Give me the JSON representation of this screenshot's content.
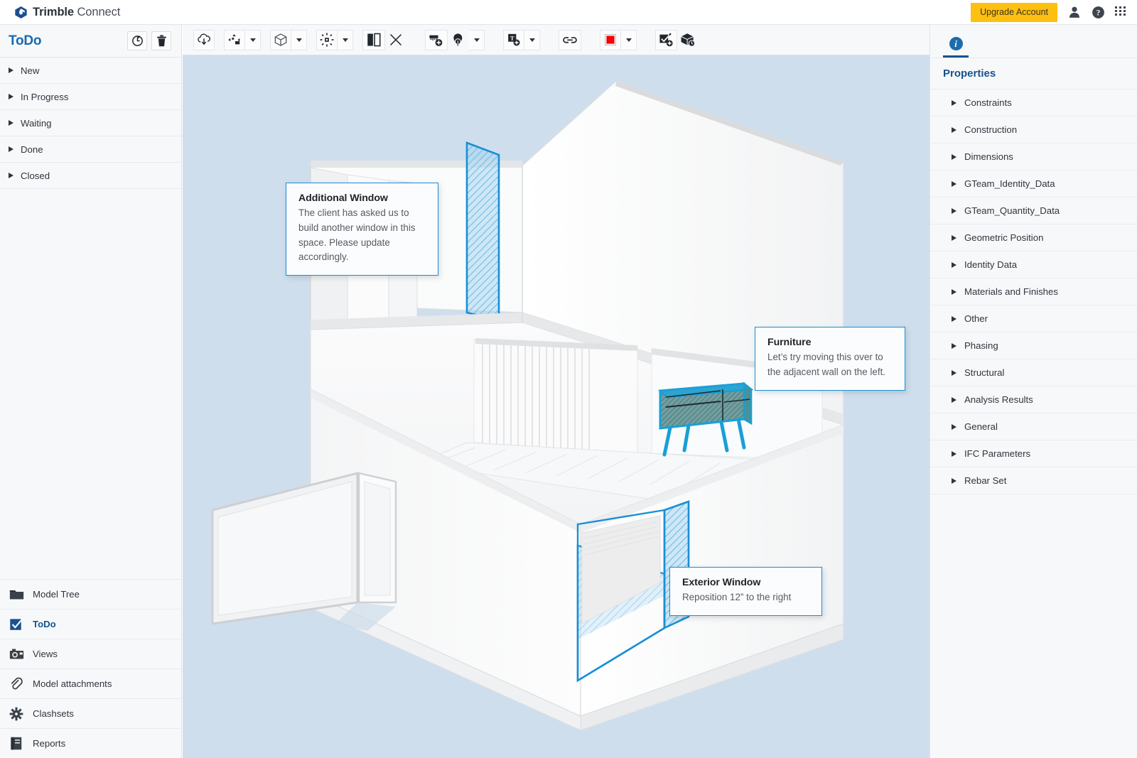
{
  "header": {
    "brand_bold": "Trimble",
    "brand_light": "Connect",
    "brand_logo_icon": "trimble-logo-icon",
    "upgrade_label": "Upgrade Account",
    "user_icon": "user-icon",
    "help_icon": "help-question-icon",
    "apps_icon": "apps-grid-icon",
    "accent_yellow": "#fdc010"
  },
  "sidebar": {
    "title": "ToDo",
    "title_color": "#1a69b0",
    "actions": [
      {
        "name": "refresh-button",
        "icon": "refresh-sync-icon"
      },
      {
        "name": "delete-button",
        "icon": "trash-icon"
      }
    ],
    "statuses": [
      {
        "label": "New"
      },
      {
        "label": "In Progress"
      },
      {
        "label": "Waiting"
      },
      {
        "label": "Done"
      },
      {
        "label": "Closed"
      }
    ],
    "nav": [
      {
        "label": "Model Tree",
        "icon": "folder-icon",
        "active": false
      },
      {
        "label": "ToDo",
        "icon": "checkbox-icon",
        "active": true
      },
      {
        "label": "Views",
        "icon": "camera-icon",
        "active": false
      },
      {
        "label": "Model attachments",
        "icon": "paperclip-icon",
        "active": false
      },
      {
        "label": "Clashsets",
        "icon": "clash-burst-icon",
        "active": false
      },
      {
        "label": "Reports",
        "icon": "report-book-icon",
        "active": false
      }
    ]
  },
  "toolbar": {
    "buttons": [
      {
        "name": "download-model-button",
        "icon": "cloud-download-icon",
        "caret": false
      },
      {
        "name": "select-mode-button",
        "icon": "move-objects-icon",
        "caret": true
      },
      {
        "name": "view-mode-button",
        "icon": "cube-wireframe-icon",
        "caret": true
      },
      {
        "name": "clip-plane-button",
        "icon": "clip-target-icon",
        "caret": true
      },
      {
        "name": "section-box-button",
        "icon": "split-panel-icon",
        "caret": false
      },
      {
        "name": "clear-section-button",
        "icon": "close-x-icon",
        "caret": false
      },
      {
        "name": "add-measurement-button",
        "icon": "measure-plus-icon",
        "caret": false
      },
      {
        "name": "add-markup-button",
        "icon": "pin-info-icon",
        "caret": true
      },
      {
        "name": "add-text-button",
        "icon": "text-add-icon",
        "caret": true
      },
      {
        "name": "link-button",
        "icon": "link-chain-icon",
        "caret": false
      },
      {
        "name": "color-swatch-button",
        "icon": "red-color-swatch",
        "caret": true
      },
      {
        "name": "add-todo-button",
        "icon": "todo-add-icon",
        "caret": false
      },
      {
        "name": "snapshot-button",
        "icon": "cube-clock-icon",
        "caret": false
      }
    ],
    "swatch_color": "#f20505"
  },
  "viewport": {
    "background_color": "#cfdeed",
    "highlight_color": "#1a8fd4",
    "furniture_color": "#17a0d8",
    "callouts": [
      {
        "id": "additional-window",
        "title": "Additional Window",
        "body": "The client has asked us to build another window in this space. Please update accordingly."
      },
      {
        "id": "furniture",
        "title": "Furniture",
        "body": "Let’s try moving this over to the adjacent wall on the left."
      },
      {
        "id": "exterior-window",
        "title": "Exterior Window",
        "body": "Reposition 12” to the right"
      }
    ]
  },
  "right_panel": {
    "tab_icon": "info-circle-icon",
    "tab_letter": "i",
    "title": "Properties",
    "title_color": "#15538e",
    "properties": [
      {
        "label": "Constraints"
      },
      {
        "label": "Construction"
      },
      {
        "label": "Dimensions"
      },
      {
        "label": "GTeam_Identity_Data"
      },
      {
        "label": "GTeam_Quantity_Data"
      },
      {
        "label": "Geometric Position"
      },
      {
        "label": "Identity Data"
      },
      {
        "label": "Materials and Finishes"
      },
      {
        "label": "Other"
      },
      {
        "label": "Phasing"
      },
      {
        "label": "Structural"
      },
      {
        "label": "Analysis Results"
      },
      {
        "label": "General"
      },
      {
        "label": "IFC Parameters"
      },
      {
        "label": "Rebar Set"
      }
    ]
  }
}
